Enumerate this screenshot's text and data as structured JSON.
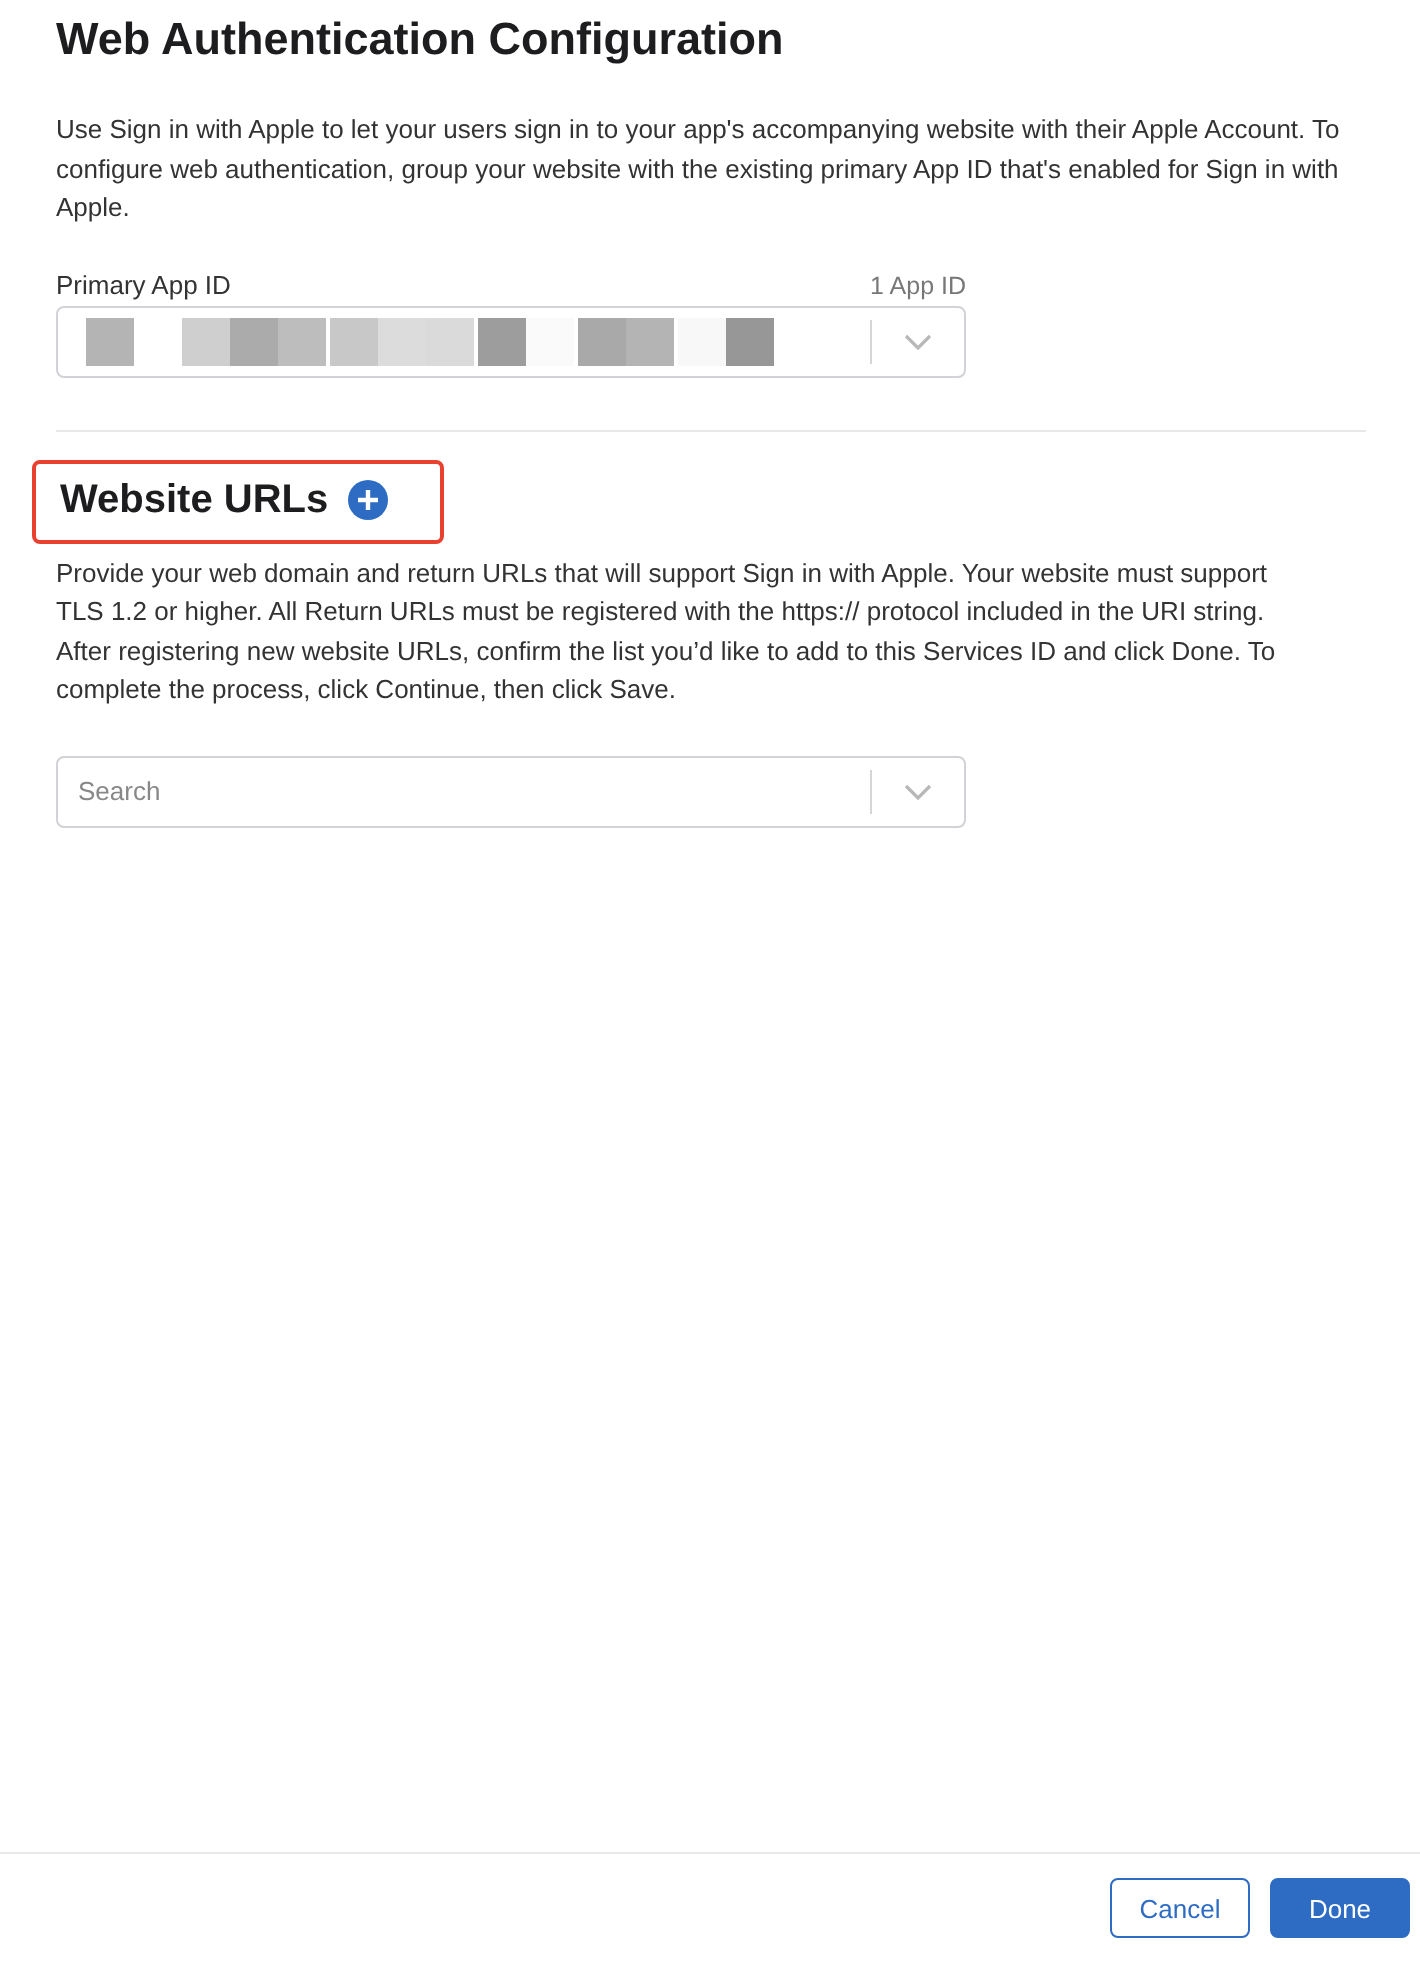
{
  "title": "Web Authentication Configuration",
  "intro": "Use Sign in with Apple to let your users sign in to your app's accompanying website with their Apple Account. To configure web authentication, group your website with the existing primary App ID that's enabled for Sign in with Apple.",
  "primary_app_id": {
    "label": "Primary App ID",
    "count": "1 App ID"
  },
  "website_urls": {
    "heading": "Website URLs",
    "highlighted": true,
    "description": "Provide your web domain and return URLs that will support Sign in with Apple. Your website must support TLS 1.2 or higher. All Return URLs must be registered with the https:// protocol included in the URI string. After registering new website URLs, confirm the list you’d like to add to this Services ID and click Done. To complete the process, click Continue, then click Save.",
    "search": {
      "placeholder": "Search"
    }
  },
  "buttons": [
    {
      "label": "Cancel",
      "kind": "secondary"
    },
    {
      "label": "Done",
      "kind": "primary"
    }
  ]
}
